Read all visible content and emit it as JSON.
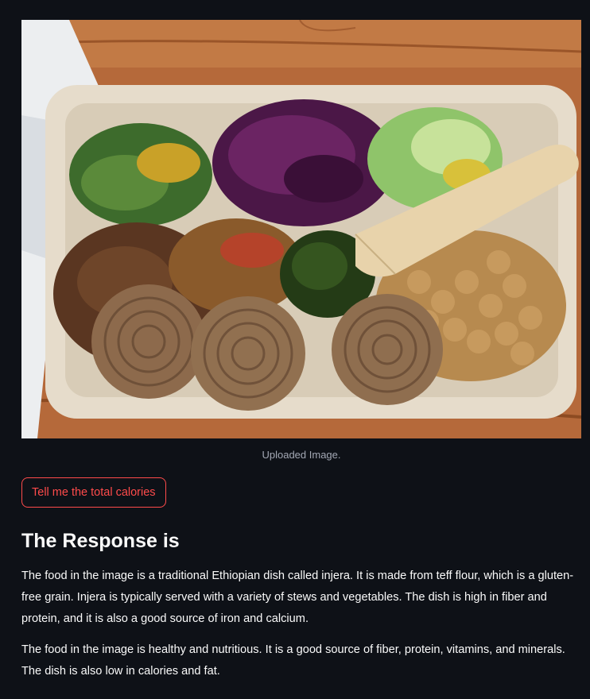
{
  "image": {
    "caption": "Uploaded Image.",
    "subject": "injera-plate-photo"
  },
  "action": {
    "button_label": "Tell me the total calories"
  },
  "response": {
    "heading": "The Response is",
    "paragraphs": [
      "The food in the image is a traditional Ethiopian dish called injera. It is made from teff flour, which is a gluten-free grain. Injera is typically served with a variety of stews and vegetables. The dish is high in fiber and protein, and it is also a good source of iron and calcium.",
      "The food in the image is healthy and nutritious. It is a good source of fiber, protein, vitamins, and minerals. The dish is also low in calories and fat."
    ]
  },
  "colors": {
    "background": "#0e1117",
    "text": "#fafafa",
    "accent": "#ff4b4b",
    "caption": "#a3a8b4"
  }
}
